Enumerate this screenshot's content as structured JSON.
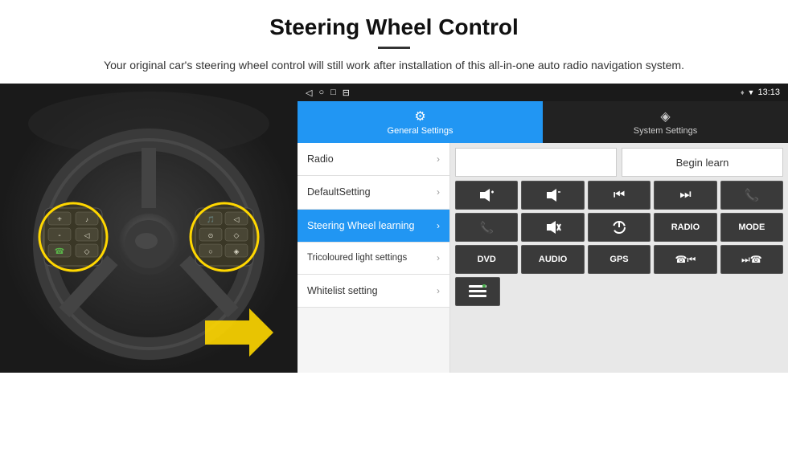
{
  "header": {
    "title": "Steering Wheel Control",
    "subtitle": "Your original car's steering wheel control will still work after installation of this all-in-one auto radio navigation system."
  },
  "status_bar": {
    "nav_back": "◁",
    "nav_home": "○",
    "nav_square": "□",
    "nav_menu": "⊟",
    "location_icon": "♦",
    "wifi_icon": "▼",
    "time": "13:13"
  },
  "tabs": [
    {
      "id": "general",
      "label": "General Settings",
      "icon": "⚙",
      "active": true
    },
    {
      "id": "system",
      "label": "System Settings",
      "icon": "◈",
      "active": false
    }
  ],
  "menu_items": [
    {
      "label": "Radio",
      "active": false
    },
    {
      "label": "DefaultSetting",
      "active": false
    },
    {
      "label": "Steering Wheel learning",
      "active": true
    },
    {
      "label": "Tricoloured light settings",
      "active": false
    },
    {
      "label": "Whitelist setting",
      "active": false
    }
  ],
  "begin_learn_btn": "Begin learn",
  "control_buttons": {
    "row1": [
      {
        "label": "🔊+",
        "type": "icon"
      },
      {
        "label": "🔊-",
        "type": "icon"
      },
      {
        "label": "⏮",
        "type": "icon"
      },
      {
        "label": "⏭",
        "type": "icon"
      },
      {
        "label": "📞",
        "type": "icon"
      }
    ],
    "row2": [
      {
        "label": "📞",
        "type": "icon-green"
      },
      {
        "label": "🔇",
        "type": "icon"
      },
      {
        "label": "⏻",
        "type": "icon"
      },
      {
        "label": "RADIO",
        "type": "text"
      },
      {
        "label": "MODE",
        "type": "text"
      }
    ],
    "row3": [
      {
        "label": "DVD",
        "type": "text"
      },
      {
        "label": "AUDIO",
        "type": "text"
      },
      {
        "label": "GPS",
        "type": "text"
      },
      {
        "label": "📞⏮",
        "type": "icon"
      },
      {
        "label": "⏭📞",
        "type": "icon"
      }
    ],
    "row4": [
      {
        "label": "≡",
        "type": "icon"
      }
    ]
  }
}
